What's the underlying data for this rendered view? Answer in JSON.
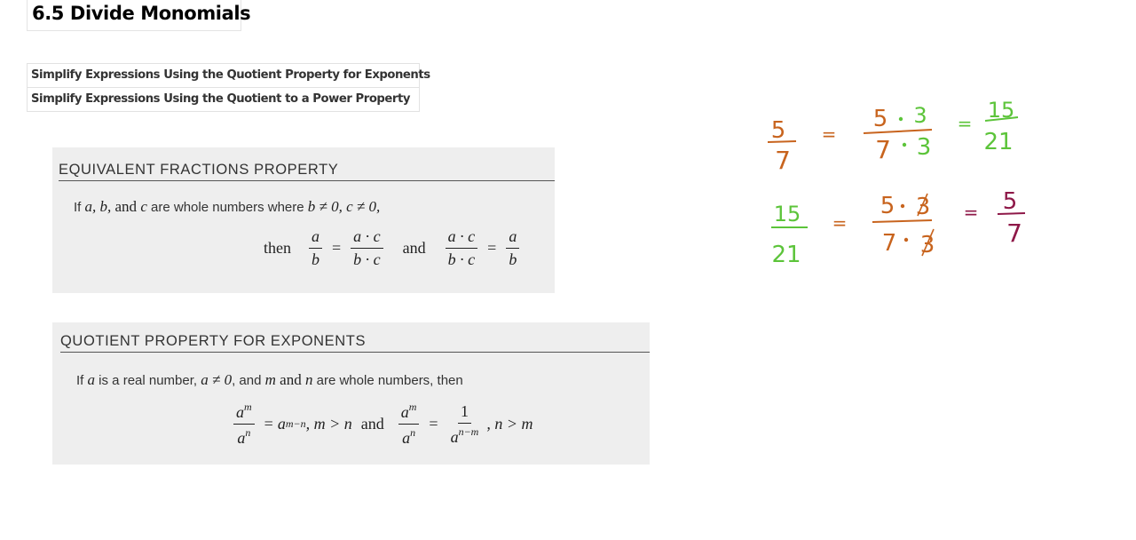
{
  "page": {
    "title": "6.5 Divide Monomials",
    "links": [
      "Simplify Expressions Using the Quotient Property for Exponents",
      "Simplify Expressions Using the Quotient to a Power Property"
    ]
  },
  "equivalent_fractions": {
    "heading": "EQUIVALENT FRACTIONS PROPERTY",
    "line1": {
      "if": "If ",
      "vars": "a, b,",
      "and": " and ",
      "c": "c",
      "mid": " are whole numbers where ",
      "cond": "b ≠ 0, c ≠ 0,"
    },
    "formula": {
      "then": "then",
      "f1_num": "a",
      "f1_den": "b",
      "eq": "=",
      "f2_num": "a · c",
      "f2_den": "b · c",
      "and": "and",
      "f3_num": "a · c",
      "f3_den": "b · c",
      "f4_num": "a",
      "f4_den": "b"
    }
  },
  "quotient_property": {
    "heading": "QUOTIENT PROPERTY FOR EXPONENTS",
    "line1": {
      "if": "If ",
      "a": "a",
      "mid1": " is a real number, ",
      "cond": "a ≠ 0",
      "mid2": ", and ",
      "m": "m",
      "and": " and ",
      "n": "n",
      "tail": " are whole numbers, then"
    },
    "formula": {
      "base": "a",
      "exp_m": "m",
      "exp_n": "n",
      "eq": "=",
      "exp_m_minus_n": "m−n",
      "cond1": ", m > n",
      "and": "and",
      "one": "1",
      "exp_n_minus_m": "n−m",
      "cond2": ", n > m"
    }
  },
  "handwriting": {
    "colors": {
      "orange": "#c8641e",
      "green": "#5cc43a",
      "maroon": "#8e1848"
    },
    "line1": {
      "a_num": "5",
      "a_den": "7",
      "b_num_left": "5",
      "b_num_right": "3",
      "b_den_left": "7",
      "b_den_right": "3",
      "c_num": "15",
      "c_den": "21"
    },
    "line2": {
      "a_num": "15",
      "a_den": "21",
      "b_num_left": "5",
      "b_num_right": "3",
      "b_den_left": "7",
      "b_den_right": "3",
      "c_num": "5",
      "c_den": "7"
    }
  }
}
